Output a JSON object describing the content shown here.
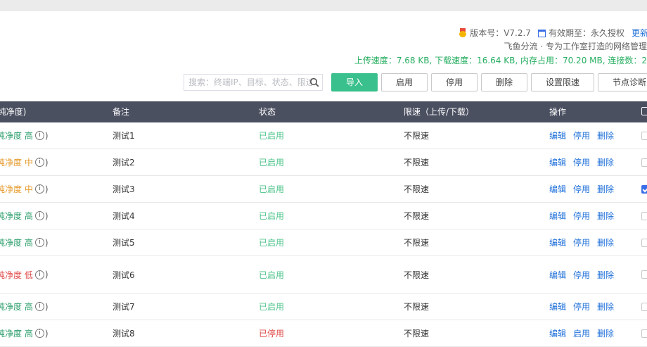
{
  "header": {
    "version_label": "版本号：",
    "version_value": "V7.2.7",
    "expiry_label": "有效期至：",
    "expiry_value": "永久授权",
    "update_link": "更新",
    "tagline": "飞鱼分流 · 专为工作室打造的网络管理",
    "stats": "上传速度：7.68 KB, 下载速度：16.64 KB, 内存占用：70.20 MB, 连接数：2"
  },
  "toolbar": {
    "search_placeholder": "搜索：终端IP、目标、状态、限速",
    "import_label": "导入",
    "enable_label": "启用",
    "disable_label": "停用",
    "delete_label": "删除",
    "limit_label": "设置限速",
    "node_label": "节点诊断"
  },
  "table": {
    "headers": {
      "purity": "(纯净度)",
      "note": "备注",
      "status": "状态",
      "speed": "限速（上传/下载）",
      "ops": "操作"
    },
    "ops": {
      "edit": "编辑",
      "disable": "停用",
      "enable": "启用",
      "delete": "删除"
    },
    "rows": [
      {
        "purity_label": "纯净度",
        "purity_level": "高",
        "note": "测试1",
        "status": "已启用",
        "speed": "不限速",
        "toggle": "停用",
        "checked": false
      },
      {
        "purity_label": "纯净度",
        "purity_level": "中",
        "note": "测试2",
        "status": "已启用",
        "speed": "不限速",
        "toggle": "停用",
        "checked": false
      },
      {
        "purity_label": "纯净度",
        "purity_level": "中",
        "note": "测试3",
        "status": "已启用",
        "speed": "不限速",
        "toggle": "停用",
        "checked": true
      },
      {
        "purity_label": "纯净度",
        "purity_level": "高",
        "note": "测试4",
        "status": "已启用",
        "speed": "不限速",
        "toggle": "停用",
        "checked": false
      },
      {
        "purity_label": "纯净度",
        "purity_level": "高",
        "note": "测试5",
        "status": "已启用",
        "speed": "不限速",
        "toggle": "停用",
        "checked": false
      },
      {
        "purity_label": "纯净度",
        "purity_level": "低",
        "note": "测试6",
        "status": "已启用",
        "speed": "不限速",
        "toggle": "停用",
        "checked": false
      },
      {
        "purity_label": "纯净度",
        "purity_level": "高",
        "note": "测试7",
        "status": "已启用",
        "speed": "不限速",
        "toggle": "停用",
        "checked": false
      },
      {
        "purity_label": "纯净度",
        "purity_level": "高",
        "note": "测试8",
        "status": "已停用",
        "speed": "不限速",
        "toggle": "启用",
        "checked": false
      }
    ]
  },
  "colors": {
    "purity_high": "#2a9d6a",
    "purity_mid": "#e69a2c",
    "purity_low": "#e04a4a",
    "header_bg": "#4b5061",
    "accent_green": "#39c08c",
    "link_blue": "#1e6fd9"
  }
}
